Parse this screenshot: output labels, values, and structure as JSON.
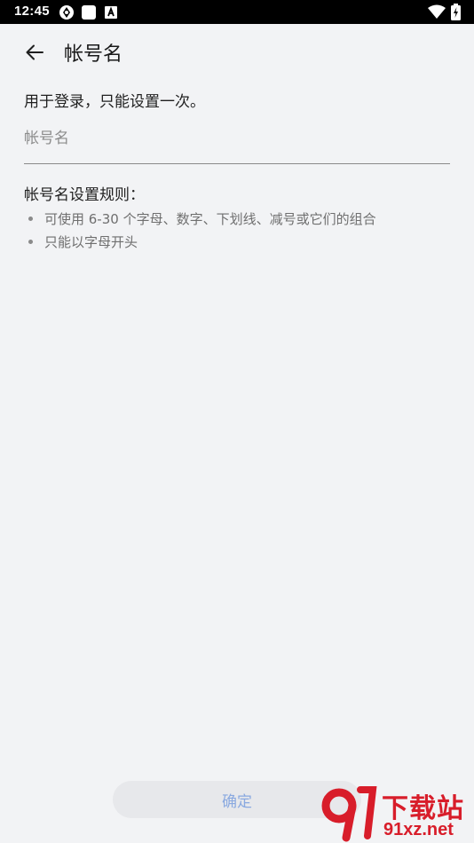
{
  "status_bar": {
    "time": "12:45",
    "left_icons": [
      "sync-icon",
      "square-icon",
      "a-badge-icon"
    ],
    "right_icons": [
      "wifi-icon",
      "battery-charging-icon"
    ]
  },
  "toolbar": {
    "back_icon": "arrow-left-icon",
    "title": "帐号名"
  },
  "form": {
    "hint": "用于登录，只能设置一次。",
    "username_value": "",
    "username_placeholder": "帐号名"
  },
  "rules": {
    "title": "帐号名设置规则：",
    "items": [
      "可使用 6-30 个字母、数字、下划线、减号或它们的组合",
      "只能以字母开头"
    ]
  },
  "confirm_button": {
    "label": "确定",
    "enabled": false
  },
  "watermark": {
    "top_text": "下载站",
    "bottom_text": "91xz.net"
  },
  "colors": {
    "background": "#f2f3f5",
    "button_disabled_text": "#8aa9e0",
    "watermark_red": "#d81d2a"
  }
}
